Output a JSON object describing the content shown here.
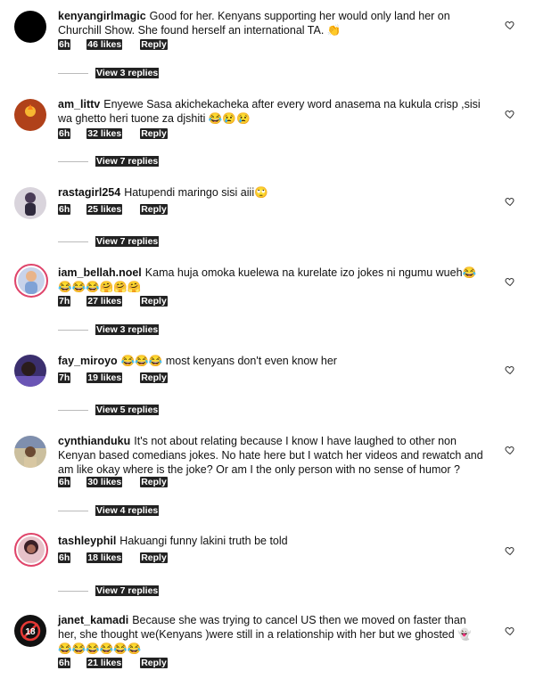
{
  "comments": [
    {
      "username": "kenyangirlmagic",
      "text": "Good for her. Kenyans supporting her would only land her on Churchill Show. She found herself an international TA. 👏",
      "time": "6h",
      "likes": "46 likes",
      "reply": "Reply",
      "view": "View 3 replies"
    },
    {
      "username": "am_littv",
      "text": "Enyewe Sasa akichekacheka after every word anasema  na kukula crisp ,sisi wa ghetto heri tuone za djshiti 😂😢😢",
      "time": "6h",
      "likes": "32 likes",
      "reply": "Reply",
      "view": "View 7 replies"
    },
    {
      "username": "rastagirl254",
      "text": "Hatupendi maringo sisi aiii🙄",
      "time": "6h",
      "likes": "25 likes",
      "reply": "Reply",
      "view": "View 7 replies"
    },
    {
      "username": "iam_bellah.noel",
      "text": "Kama huja omoka kuelewa na kurelate izo jokes ni ngumu wueh😂😂😂😂🤗🤗🤗",
      "time": "7h",
      "likes": "27 likes",
      "reply": "Reply",
      "view": "View 3 replies"
    },
    {
      "username": "fay_miroyo",
      "text": "😂😂😂 most kenyans don't even know her",
      "time": "7h",
      "likes": "19 likes",
      "reply": "Reply",
      "view": "View 5 replies"
    },
    {
      "username": "cynthianduku",
      "text": "It's not about relating because I know I have laughed to other non Kenyan based comedians jokes. No hate here but I watch her videos and rewatch and am like okay where is the joke? Or am I the only person with no sense of humor ?",
      "time": "6h",
      "likes": "30 likes",
      "reply": "Reply",
      "view": "View 4 replies"
    },
    {
      "username": "tashleyphil",
      "text": "Hakuangi funny lakini truth be told",
      "time": "6h",
      "likes": "18 likes",
      "reply": "Reply",
      "view": "View 7 replies"
    },
    {
      "username": "janet_kamadi",
      "text": "Because she was trying to cancel US then we moved on faster  than her, she thought we(Kenyans )were still in a relationship  with her but we ghosted 👻 😂😂😂😂😂😂",
      "time": "6h",
      "likes": "21 likes",
      "reply": "Reply",
      "view": ""
    }
  ],
  "avatars": [
    {
      "icon": "black-circle-avatar",
      "color": "#000000"
    },
    {
      "icon": "am-littv-logo-avatar",
      "color": "#b0411a",
      "text": "AM LITTV"
    },
    {
      "icon": "person-photo-avatar",
      "color": "#6b6077"
    },
    {
      "icon": "person-photo-avatar",
      "color": "#8aa0c8"
    },
    {
      "icon": "person-photo-avatar",
      "color": "#4a3a7a"
    },
    {
      "icon": "person-photo-avatar",
      "color": "#b7a78a"
    },
    {
      "icon": "person-photo-avatar",
      "color": "#a04060"
    },
    {
      "icon": "18-plus-avatar",
      "color": "#111111",
      "text": "18"
    }
  ]
}
